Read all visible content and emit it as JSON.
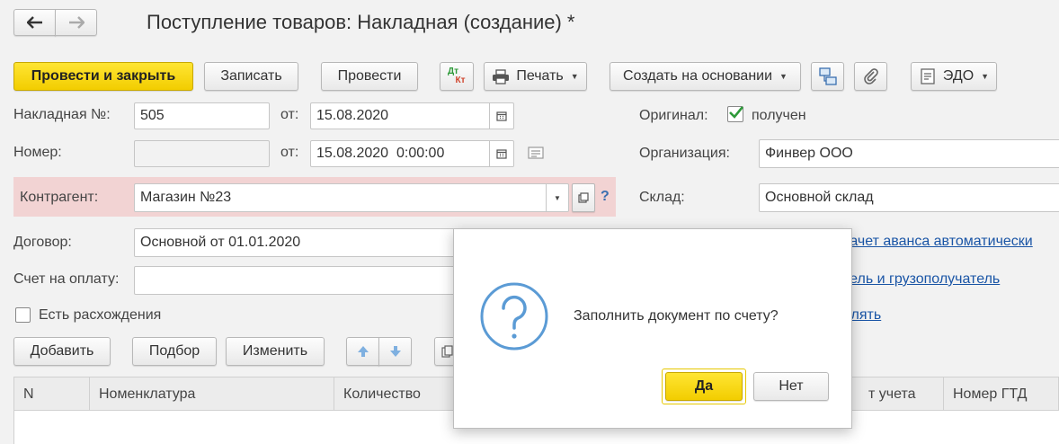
{
  "window": {
    "title": "Поступление товаров: Накладная (создание) *"
  },
  "toolbar": {
    "post_close": "Провести и закрыть",
    "save": "Записать",
    "post": "Провести",
    "dtkt_top": "Дт",
    "dtkt_bottom": "Кт",
    "print": "Печать",
    "create_based": "Создать на основании",
    "edo": "ЭДО"
  },
  "form": {
    "invoice_label": "Накладная №:",
    "invoice_value": "505",
    "from_label": "от:",
    "invoice_date": "15.08.2020",
    "number_label": "Номер:",
    "number_value": "",
    "number_from_label": "от:",
    "number_date": "15.08.2020  0:00:00",
    "counterparty_label": "Контрагент:",
    "counterparty_value": "Магазин №23",
    "help": "?",
    "contract_label": "Договор:",
    "contract_value": "Основной от 01.01.2020",
    "payment_label": "Счет на оплату:",
    "payment_value": "",
    "discrepancy_label": "Есть расхождения",
    "original_label": "Оригинал:",
    "original_value": "получен",
    "organization_label": "Организация:",
    "organization_value": "Финвер ООО",
    "warehouse_label": "Склад:",
    "warehouse_value": "Основной склад",
    "advance_link": "зачет аванса автоматически",
    "consignee_link": "тель и грузополучатель",
    "fill_link": "олять"
  },
  "table_toolbar": {
    "add": "Добавить",
    "select": "Подбор",
    "change": "Изменить"
  },
  "table": {
    "columns": [
      "N",
      "Номенклатура",
      "Количество",
      "т учета",
      "Номер ГТД"
    ]
  },
  "dialog": {
    "message": "Заполнить документ по счету?",
    "yes": "Да",
    "no": "Нет"
  },
  "colors": {
    "primary_yellow": "#f5d000",
    "highlight_pink": "#f2d3d3",
    "link_blue": "#1a55a6",
    "question_blue": "#5b9bd5",
    "check_green": "#2e9a3a"
  }
}
